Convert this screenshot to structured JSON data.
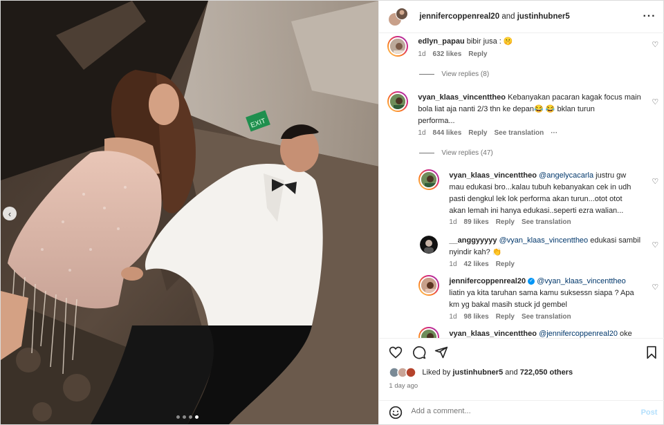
{
  "post": {
    "header_user": "jennifercoppenreal20",
    "header_and": "and",
    "header_coauthor": "justinhubner5",
    "more_icon": "more-horizontal-icon",
    "photo_exit_sign": "EXIT",
    "carousel": {
      "total": 4,
      "active": 4
    }
  },
  "comments": [
    {
      "user": "edlyn_papau",
      "text": "bibir jusa : 🤫",
      "time": "1d",
      "likes": "632 likes",
      "reply": "Reply",
      "view_replies": "View replies (8)"
    },
    {
      "user": "vyan_klaas_vincenttheo",
      "line1": "Kebanyakan pacaran kagak focus main",
      "line2": "bola liat aja nanti 2/3 thn ke depan😂 😂  bklan turun",
      "line3": "performa...",
      "time": "1d",
      "likes": "844 likes",
      "reply": "Reply",
      "translate": "See translation",
      "view_replies": "View replies (47)"
    },
    {
      "user": "vyan_klaas_vincenttheo",
      "mention": "@angelycacarla",
      "line1": "justru gw",
      "line2": "mau edukasi bro...kalau tubuh kebanyakan cek in udh",
      "line3": "pasti dengkul lek lok performa akan turun...otot otot",
      "line4": "akan lemah ini hanya edukasi..seperti ezra walian...",
      "time": "1d",
      "likes": "89 likes",
      "reply": "Reply",
      "translate": "See translation"
    },
    {
      "user": "__anggyyyyy",
      "mention": "@vyan_klaas_vincenttheo",
      "line1": "edukasi sambil",
      "line2": "nyindir kah? 👏",
      "time": "1d",
      "likes": "42 likes",
      "reply": "Reply"
    },
    {
      "user": "jennifercoppenreal20",
      "mention": "@vyan_klaas_vincenttheo",
      "line2": "liatin ya kita taruhan sama kamu suksessn siapa ? Apa",
      "line3": "km yg bakal masih stuck jd gembel",
      "time": "1d",
      "likes": "98 likes",
      "reply": "Reply",
      "translate": "See translation"
    },
    {
      "user": "vyan_klaas_vincenttheo",
      "mention": "@jennifercoppenreal20",
      "line1": "oke"
    }
  ],
  "actions": {
    "like_icon": "heart-icon",
    "comment_icon": "comment-icon",
    "share_icon": "share-icon",
    "save_icon": "bookmark-icon"
  },
  "likes_summary": {
    "prefix": "Liked by",
    "user": "justinhubner5",
    "and": "and",
    "others": "722,050 others"
  },
  "time_ago": "1 day ago",
  "add_comment": {
    "placeholder": "Add a comment...",
    "post_label": "Post",
    "emoji_icon": "emoji-icon"
  },
  "colors": {
    "link_blue": "#00376b",
    "verified_blue": "#0095f6",
    "post_disabled": "#b2dffc",
    "muted": "#737373"
  }
}
